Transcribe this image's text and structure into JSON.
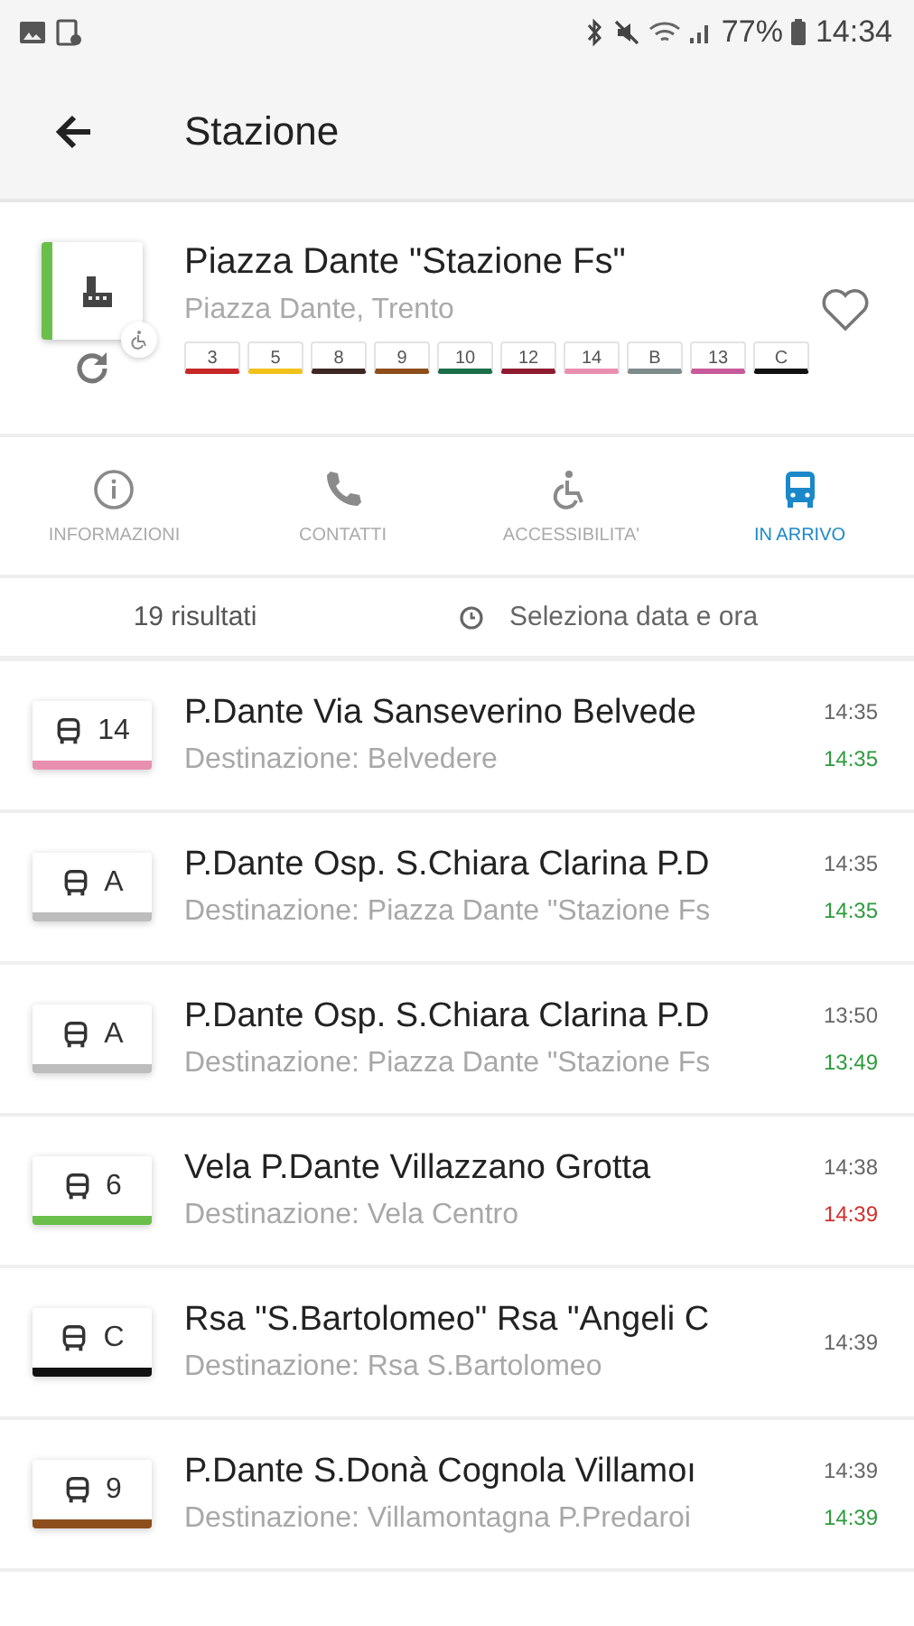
{
  "status_bar": {
    "battery": "77%",
    "time": "14:34"
  },
  "app_bar": {
    "title": "Stazione"
  },
  "stop": {
    "name": "Piazza Dante \"Stazione Fs\"",
    "address": "Piazza Dante, Trento",
    "color": "#6abf4b",
    "favorite": false,
    "lines": [
      {
        "label": "3",
        "color": "#c62828"
      },
      {
        "label": "5",
        "color": "#f2c21b"
      },
      {
        "label": "8",
        "color": "#3e2723"
      },
      {
        "label": "9",
        "color": "#8d4e1c"
      },
      {
        "label": "10",
        "color": "#1b6e4a"
      },
      {
        "label": "12",
        "color": "#8e1b2f"
      },
      {
        "label": "14",
        "color": "#e88fb0"
      },
      {
        "label": "B",
        "color": "#7d8c8a"
      },
      {
        "label": "13",
        "color": "#c75a9a"
      },
      {
        "label": "C",
        "color": "#111111"
      }
    ]
  },
  "tabs": [
    {
      "label": "INFORMAZIONI",
      "kind": "info",
      "selected": false
    },
    {
      "label": "CONTATTI",
      "kind": "contacts",
      "selected": false
    },
    {
      "label": "ACCESSIBILITA'",
      "kind": "accessibility",
      "selected": false
    },
    {
      "label": "IN ARRIVO",
      "kind": "arrivals",
      "selected": true
    }
  ],
  "results": {
    "count": "19 risultati",
    "date_picker": "Seleziona data e ora"
  },
  "arrivals": [
    {
      "line": "14",
      "color": "#e88fb0",
      "route": "P.Dante Via Sanseverino Belvede",
      "destination": "Destinazione: Belvedere",
      "scheduled": "14:35",
      "realtime": "14:35",
      "late": false
    },
    {
      "line": "A",
      "color": "#bdbdbd",
      "route": "P.Dante Osp. S.Chiara Clarina P.D",
      "destination": "Destinazione: Piazza Dante \"Stazione Fs",
      "scheduled": "14:35",
      "realtime": "14:35",
      "late": false
    },
    {
      "line": "A",
      "color": "#bdbdbd",
      "route": "P.Dante Osp. S.Chiara Clarina P.D",
      "destination": "Destinazione: Piazza Dante \"Stazione Fs",
      "scheduled": "13:50",
      "realtime": "13:49",
      "late": false
    },
    {
      "line": "6",
      "color": "#6abf4b",
      "route": "Vela P.Dante Villazzano Grotta",
      "destination": "Destinazione: Vela Centro",
      "scheduled": "14:38",
      "realtime": "14:39",
      "late": true
    },
    {
      "line": "C",
      "color": "#111111",
      "route": "Rsa \"S.Bartolomeo\" Rsa \"Angeli C",
      "destination": "Destinazione: Rsa S.Bartolomeo",
      "scheduled": "14:39"
    },
    {
      "line": "9",
      "color": "#8d4e1c",
      "route": "P.Dante S.Donà Cognola Villamoı",
      "destination": "Destinazione: Villamontagna P.Predaroi",
      "scheduled": "14:39",
      "realtime": "14:39",
      "late": false
    }
  ]
}
